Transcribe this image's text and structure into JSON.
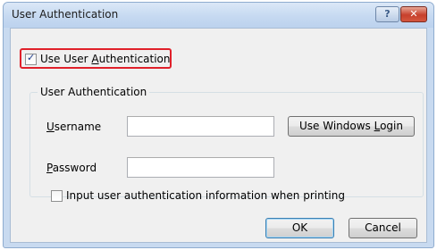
{
  "dialog": {
    "title": "User Authentication",
    "help_glyph": "?",
    "close_glyph": "✕"
  },
  "use_auth": {
    "checked": true,
    "label_prefix": "Use User ",
    "label_accel": "A",
    "label_suffix": "uthentication"
  },
  "group": {
    "title": "User Authentication",
    "username_label_accel": "U",
    "username_label_rest": "sername",
    "username_value": "",
    "password_label_accel": "P",
    "password_label_rest": "assword",
    "password_value": "",
    "windows_login_prefix": "Use Windows ",
    "windows_login_accel": "L",
    "windows_login_suffix": "ogin",
    "input_when_printing": {
      "checked": false,
      "label": "Input user authentication information when printing"
    }
  },
  "footer": {
    "ok_label": "OK",
    "cancel_label": "Cancel"
  },
  "colors": {
    "highlight": "#e0202a",
    "close_button": "#c7402c"
  }
}
